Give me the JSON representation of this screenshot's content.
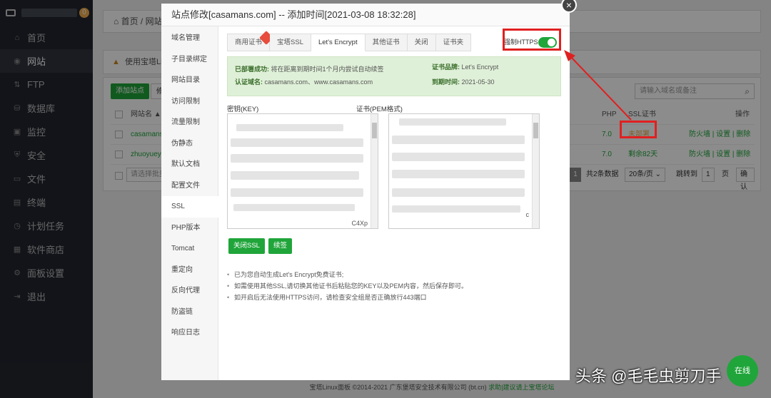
{
  "sidebar": {
    "badge": "0",
    "items": [
      {
        "icon": "⌂",
        "label": "首页"
      },
      {
        "icon": "◉",
        "label": "网站"
      },
      {
        "icon": "⇅",
        "label": "FTP"
      },
      {
        "icon": "⛁",
        "label": "数据库"
      },
      {
        "icon": "▣",
        "label": "监控"
      },
      {
        "icon": "⛨",
        "label": "安全"
      },
      {
        "icon": "▭",
        "label": "文件"
      },
      {
        "icon": "▤",
        "label": "终端"
      },
      {
        "icon": "◷",
        "label": "计划任务"
      },
      {
        "icon": "▦",
        "label": "软件商店"
      },
      {
        "icon": "⚙",
        "label": "面板设置"
      },
      {
        "icon": "⇥",
        "label": "退出"
      }
    ]
  },
  "main": {
    "breadcrumb": "⌂ 首页 / 网站",
    "warning": "使用宝塔Lin",
    "add_site": "添加站点",
    "mod": "修",
    "search_placeholder": "请输入域名或备注",
    "table": {
      "headers": {
        "name": "网站名 ▲",
        "php": "PHP",
        "ssl": "SSL证书",
        "ops": "操作"
      },
      "rows": [
        {
          "name": "casamans.",
          "php": "7.0",
          "ssl": "未部署",
          "ops": "防火墙 | 设置 | 删除"
        },
        {
          "name": "zhuoyueyu",
          "php": "7.0",
          "ssl": "剩余82天",
          "ops": "防火墙 | 设置 | 删除"
        }
      ]
    },
    "pager": {
      "batch": "请选择批量",
      "page": "1",
      "total": "共2条数据",
      "per": "20条/页",
      "jump": "跳转到",
      "jump_page": "1",
      "unit": "页",
      "confirm": "确认"
    },
    "footer": "宝塔Linux面板 ©2014-2021 广东堡塔安全技术有限公司 (bt.cn)",
    "footer_link": "求助|建议请上宝塔论坛"
  },
  "modal": {
    "title": "站点修改[casamans.com] -- 添加时间[2021-03-08 18:32:28]",
    "side_items": [
      "域名管理",
      "子目录绑定",
      "网站目录",
      "访问限制",
      "流量限制",
      "伪静态",
      "默认文档",
      "配置文件",
      "SSL",
      "PHP版本",
      "Tomcat",
      "重定向",
      "反向代理",
      "防盗链",
      "响应日志"
    ],
    "tabs": [
      "商用证书",
      "宝塔SSL",
      "Let's Encrypt",
      "其他证书",
      "关闭",
      "证书夹"
    ],
    "force_https": "强制HTTPS",
    "info": {
      "deployed_label": "已部署成功:",
      "deployed_text": "将在距离到期时间1个月内尝试自动续签",
      "brand_label": "证书品牌:",
      "brand": "Let's Encrypt",
      "domain_label": "认证域名:",
      "domains": "casamans.com、www.casamans.com",
      "expire_label": "到期时间:",
      "expire": "2021-05-30"
    },
    "key_label": "密钥(KEY)",
    "cert_label": "证书(PEM格式)",
    "key_frag": "C4Xp",
    "cert_frag": "c",
    "btn_close_ssl": "关闭SSL",
    "btn_renew": "续签",
    "notes": [
      "已为您自动生成Let's Encrypt免费证书;",
      "如需使用其他SSL,请切换其他证书后粘贴您的KEY以及PEM内容，然后保存即可。",
      "如开启后无法使用HTTPS访问，请检查安全组是否正确放行443端口"
    ]
  },
  "watermark": "头条 @毛毛虫剪刀手",
  "online": "在线",
  "colors": {
    "accent": "#20a53a",
    "highlight": "#e02020",
    "sidebar": "#23262e"
  }
}
